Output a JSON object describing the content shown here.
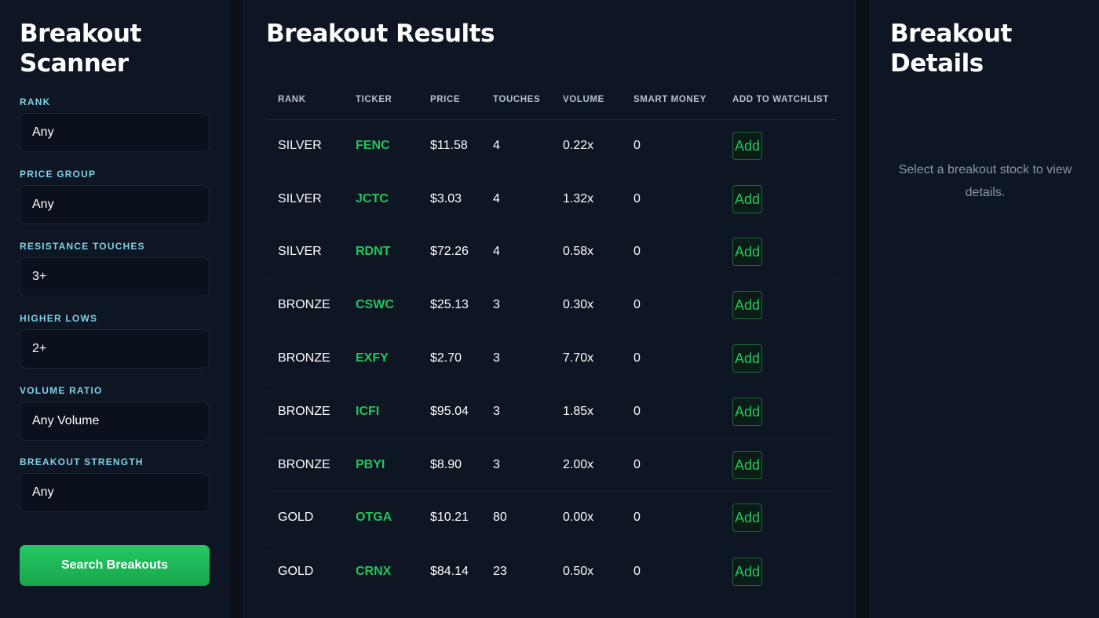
{
  "scanner": {
    "title": "Breakout Scanner",
    "filters": [
      {
        "label": "RANK",
        "value": "Any"
      },
      {
        "label": "PRICE GROUP",
        "value": "Any"
      },
      {
        "label": "RESISTANCE TOUCHES",
        "value": "3+"
      },
      {
        "label": "HIGHER LOWS",
        "value": "2+"
      },
      {
        "label": "VOLUME RATIO",
        "value": "Any Volume"
      },
      {
        "label": "BREAKOUT STRENGTH",
        "value": "Any"
      }
    ],
    "search_label": "Search Breakouts"
  },
  "results": {
    "title": "Breakout Results",
    "columns": [
      "RANK",
      "TICKER",
      "PRICE",
      "TOUCHES",
      "VOLUME",
      "SMART MONEY",
      "ADD TO WATCHLIST"
    ],
    "rows": [
      {
        "rank": "SILVER",
        "ticker": "FENC",
        "price": "$11.58",
        "touches": "4",
        "volume": "0.22x",
        "smart": "0",
        "action": "Add"
      },
      {
        "rank": "SILVER",
        "ticker": "JCTC",
        "price": "$3.03",
        "touches": "4",
        "volume": "1.32x",
        "smart": "0",
        "action": "Add"
      },
      {
        "rank": "SILVER",
        "ticker": "RDNT",
        "price": "$72.26",
        "touches": "4",
        "volume": "0.58x",
        "smart": "0",
        "action": "Add"
      },
      {
        "rank": "BRONZE",
        "ticker": "CSWC",
        "price": "$25.13",
        "touches": "3",
        "volume": "0.30x",
        "smart": "0",
        "action": "Add"
      },
      {
        "rank": "BRONZE",
        "ticker": "EXFY",
        "price": "$2.70",
        "touches": "3",
        "volume": "7.70x",
        "smart": "0",
        "action": "Add"
      },
      {
        "rank": "BRONZE",
        "ticker": "ICFI",
        "price": "$95.04",
        "touches": "3",
        "volume": "1.85x",
        "smart": "0",
        "action": "Add"
      },
      {
        "rank": "BRONZE",
        "ticker": "PBYI",
        "price": "$8.90",
        "touches": "3",
        "volume": "2.00x",
        "smart": "0",
        "action": "Add"
      },
      {
        "rank": "GOLD",
        "ticker": "OTGA",
        "price": "$10.21",
        "touches": "80",
        "volume": "0.00x",
        "smart": "0",
        "action": "Add"
      },
      {
        "rank": "GOLD",
        "ticker": "CRNX",
        "price": "$84.14",
        "touches": "23",
        "volume": "0.50x",
        "smart": "0",
        "action": "Add"
      }
    ]
  },
  "details": {
    "title": "Breakout Details",
    "empty_message": "Select a breakout stock to view details."
  },
  "colors": {
    "accent_green": "#22c55e",
    "label_cyan": "#7dd3e8",
    "panel_bg": "#0e1523"
  }
}
